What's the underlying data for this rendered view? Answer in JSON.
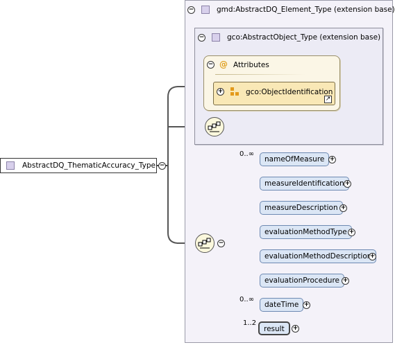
{
  "root": {
    "label": "AbstractDQ_ThematicAccuracy_Type"
  },
  "outer_type": {
    "label": "gmd:AbstractDQ_Element_Type (extension base)"
  },
  "inner_type": {
    "label": "gco:AbstractObject_Type (extension base)"
  },
  "attributes": {
    "title": "Attributes",
    "at_symbol": "@",
    "group_label": "gco:ObjectIdentification"
  },
  "elements": [
    {
      "label": "nameOfMeasure",
      "cardinality": "0..∞"
    },
    {
      "label": "measureIdentification",
      "cardinality": ""
    },
    {
      "label": "measureDescription",
      "cardinality": ""
    },
    {
      "label": "evaluationMethodType",
      "cardinality": ""
    },
    {
      "label": "evaluationMethodDescription",
      "cardinality": ""
    },
    {
      "label": "evaluationProcedure",
      "cardinality": ""
    },
    {
      "label": "dateTime",
      "cardinality": "0..∞"
    },
    {
      "label": "result",
      "cardinality": "1..2"
    }
  ],
  "symbols": {
    "collapse": "−",
    "expand": "+"
  },
  "colors": {
    "element_fill": "#dbe6f5",
    "element_border": "#6d89b2",
    "type_fill": "#f4f2f9",
    "attribute_fill": "#fbf6e6",
    "attribute_group_fill": "#f9e8b6",
    "sequence_fill": "#fbf8dd"
  }
}
